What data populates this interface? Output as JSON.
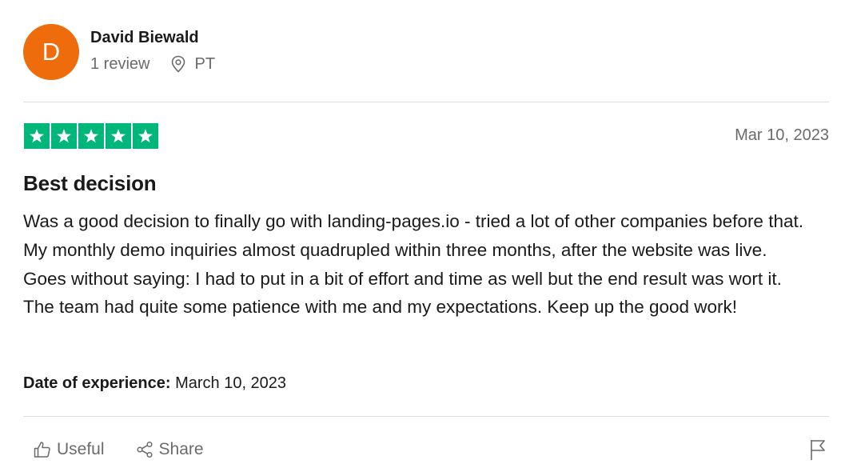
{
  "reviewer": {
    "initial": "D",
    "name": "David Biewald",
    "review_count": "1 review",
    "location": "PT",
    "avatar_color": "#ee6c0c"
  },
  "review": {
    "rating": 5,
    "max_rating": 5,
    "star_color": "#00b67a",
    "date": "Mar 10, 2023",
    "title": "Best decision",
    "text": "Was a good decision to finally go with landing-pages.io - tried a lot of other companies before that. My monthly demo inquiries almost quadrupled within three months, after the website was live. Goes without saying: I had to put in a bit of effort and time as well but the end result was wort it. The team had quite some patience with me and my expectations. Keep up the good work!",
    "experience_label": "Date of experience:",
    "experience_date": "March 10, 2023"
  },
  "actions": {
    "useful_label": "Useful",
    "share_label": "Share"
  },
  "icons": {
    "location": "location-pin-icon",
    "useful": "thumbs-up-icon",
    "share": "share-icon",
    "flag": "flag-icon",
    "star": "star-icon"
  }
}
